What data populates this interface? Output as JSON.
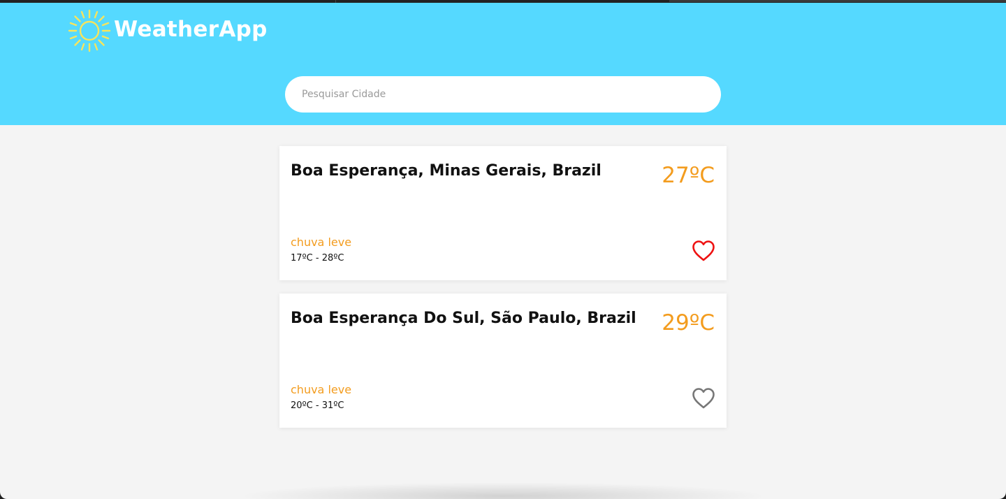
{
  "app": {
    "title": "WeatherApp",
    "header_color": "#55d9ff",
    "accent_color": "#f39c1e",
    "logo_icon": "sun-icon"
  },
  "search": {
    "placeholder": "Pesquisar Cidade",
    "value": ""
  },
  "results": [
    {
      "city": "Boa Esperança, Minas Gerais, Brazil",
      "temperature": "27ºC",
      "condition": "chuva leve",
      "range": "17ºC - 28ºC",
      "favorite": true,
      "favorite_icon": "heart-icon",
      "favorite_color": "#ee1111"
    },
    {
      "city": "Boa Esperança Do Sul, São Paulo, Brazil",
      "temperature": "29ºC",
      "condition": "chuva leve",
      "range": "20ºC - 31ºC",
      "favorite": false,
      "favorite_icon": "heart-outline-icon",
      "favorite_color": "#777777"
    }
  ]
}
